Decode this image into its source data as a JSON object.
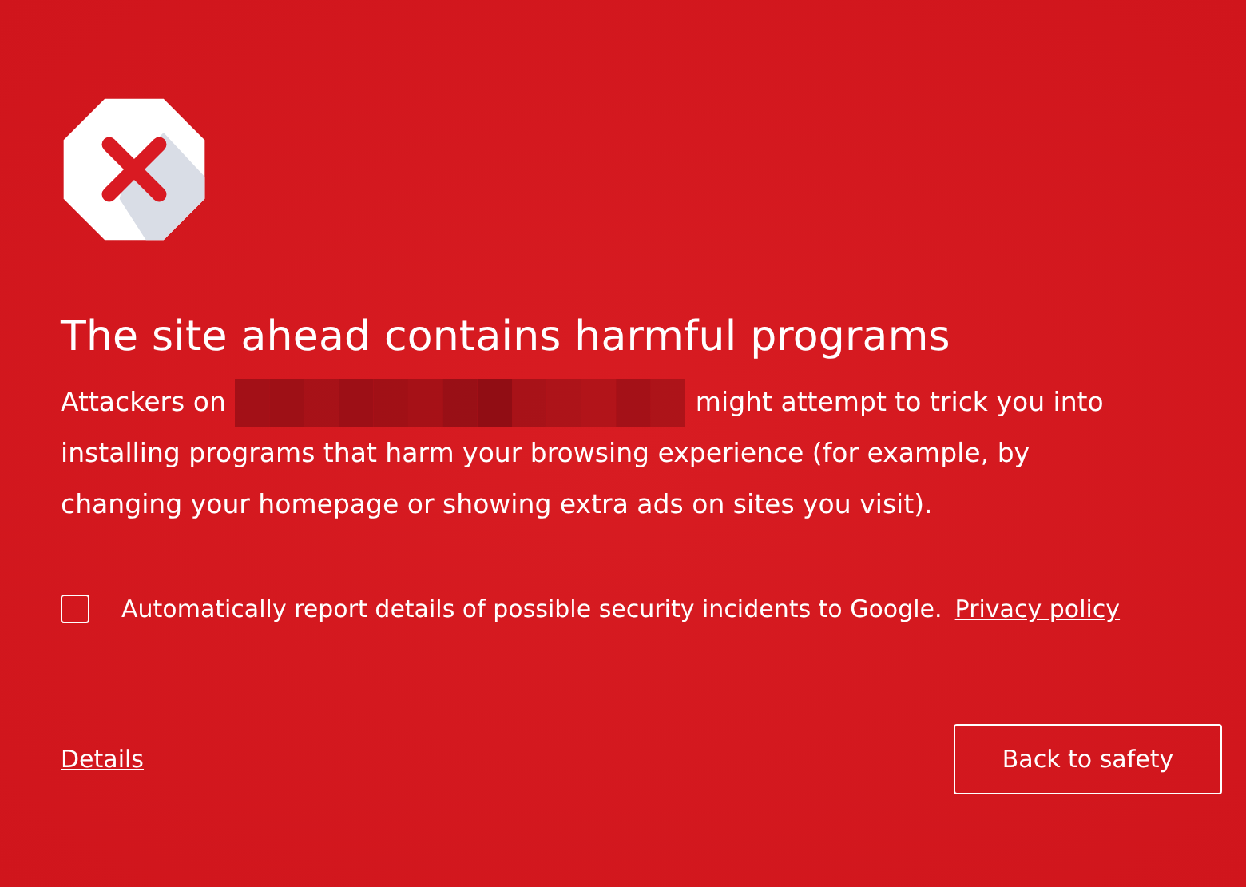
{
  "title": "The site ahead contains harmful programs",
  "message": {
    "before": "Attackers on",
    "after": "might attempt to trick you into",
    "continuation": "installing programs that harm your browsing experience (for example, by changing your homepage or showing extra ads on sites you visit)."
  },
  "report": {
    "checked": false,
    "label": "Automatically report details of possible security incidents to Google.",
    "link": "Privacy policy"
  },
  "details_link": "Details",
  "button": "Back to safety"
}
